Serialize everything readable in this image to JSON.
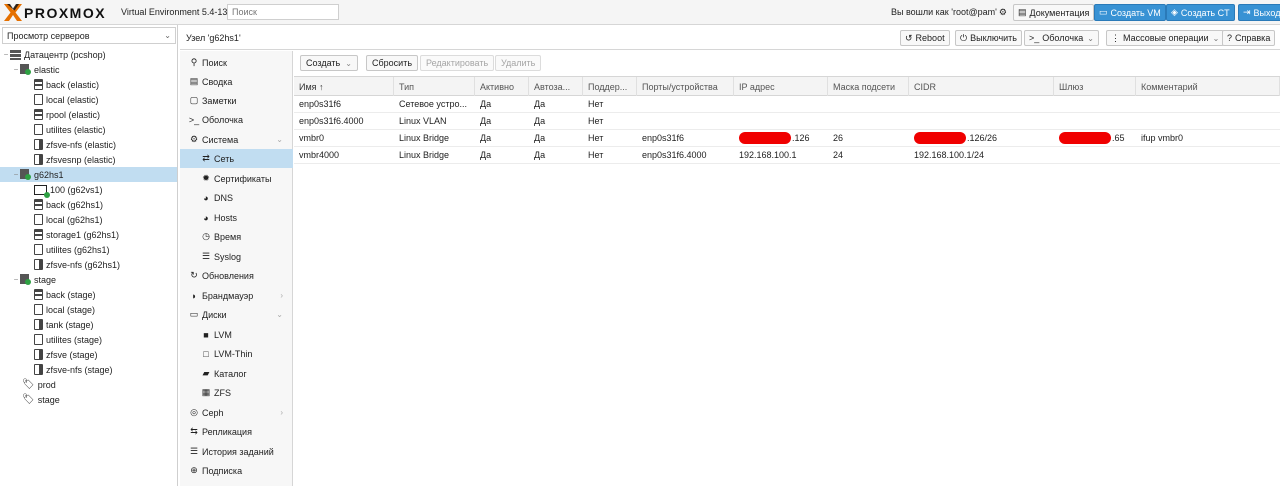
{
  "app": {
    "brand": "PROXMOX",
    "version": "Virtual Environment 5.4-13",
    "search_placeholder": "Поиск",
    "logged_in": "Вы вошли как 'root@pam'",
    "buttons": {
      "docs": "Документация",
      "create_vm": "Создать VM",
      "create_ct": "Создать CT",
      "logout": "Выход"
    },
    "accent_color": "#3892d4"
  },
  "tree": {
    "view_label": "Просмотр серверов",
    "items": [
      {
        "label": "Датацентр (pcshop)"
      },
      {
        "label": "elastic"
      },
      {
        "label": "back (elastic)"
      },
      {
        "label": "local (elastic)"
      },
      {
        "label": "rpool (elastic)"
      },
      {
        "label": "utilites (elastic)"
      },
      {
        "label": "zfsve-nfs (elastic)"
      },
      {
        "label": "zfsvesnp (elastic)"
      },
      {
        "label": "g62hs1"
      },
      {
        "label": "100 (g62vs1)"
      },
      {
        "label": "back (g62hs1)"
      },
      {
        "label": "local (g62hs1)"
      },
      {
        "label": "storage1 (g62hs1)"
      },
      {
        "label": "utilites (g62hs1)"
      },
      {
        "label": "zfsve-nfs (g62hs1)"
      },
      {
        "label": "stage"
      },
      {
        "label": "back (stage)"
      },
      {
        "label": "local (stage)"
      },
      {
        "label": "tank (stage)"
      },
      {
        "label": "utilites (stage)"
      },
      {
        "label": "zfsve (stage)"
      },
      {
        "label": "zfsve-nfs (stage)"
      },
      {
        "label": "prod"
      },
      {
        "label": "stage"
      }
    ]
  },
  "header": {
    "node_title": "Узел 'g62hs1'",
    "actions": {
      "reboot": "Reboot",
      "shutdown": "Выключить",
      "shell": "Оболочка",
      "bulk": "Массовые операции",
      "help": "Справка"
    }
  },
  "nav": {
    "items": [
      {
        "label": "Поиск"
      },
      {
        "label": "Сводка"
      },
      {
        "label": "Заметки"
      },
      {
        "label": "Оболочка"
      },
      {
        "label": "Система"
      },
      {
        "label": "Сеть"
      },
      {
        "label": "Сертификаты"
      },
      {
        "label": "DNS"
      },
      {
        "label": "Hosts"
      },
      {
        "label": "Время"
      },
      {
        "label": "Syslog"
      },
      {
        "label": "Обновления"
      },
      {
        "label": "Брандмауэр"
      },
      {
        "label": "Диски"
      },
      {
        "label": "LVM"
      },
      {
        "label": "LVM-Thin"
      },
      {
        "label": "Каталог"
      },
      {
        "label": "ZFS"
      },
      {
        "label": "Ceph"
      },
      {
        "label": "Репликация"
      },
      {
        "label": "История заданий"
      },
      {
        "label": "Подписка"
      }
    ]
  },
  "toolbar": {
    "create": "Создать",
    "reset": "Сбросить",
    "edit": "Редактировать",
    "delete": "Удалить"
  },
  "grid": {
    "columns": [
      "Имя ↑",
      "Тип",
      "Активно",
      "Автоза...",
      "Поддер...",
      "Порты/устройства",
      "IP адрес",
      "Маска подсети",
      "CIDR",
      "Шлюз",
      "Комментарий"
    ],
    "rows": [
      {
        "name": "enp0s31f6",
        "type": "Сетевое устро...",
        "active": "Да",
        "autostart": "Да",
        "vlan": "Нет",
        "ports": "",
        "ip": "",
        "mask": "",
        "cidr": "",
        "gateway": "",
        "comment": ""
      },
      {
        "name": "enp0s31f6.4000",
        "type": "Linux VLAN",
        "active": "Да",
        "autostart": "Да",
        "vlan": "Нет",
        "ports": "",
        "ip": "",
        "mask": "",
        "cidr": "",
        "gateway": "",
        "comment": ""
      },
      {
        "name": "vmbr0",
        "type": "Linux Bridge",
        "active": "Да",
        "autostart": "Да",
        "vlan": "Нет",
        "ports": "enp0s31f6",
        "ip": ".126",
        "mask": "26",
        "cidr": ".126/26",
        "gateway": ".65",
        "comment": "ifup vmbr0"
      },
      {
        "name": "vmbr4000",
        "type": "Linux Bridge",
        "active": "Да",
        "autostart": "Да",
        "vlan": "Нет",
        "ports": "enp0s31f6.4000",
        "ip": "192.168.100.1",
        "mask": "24",
        "cidr": "192.168.100.1/24",
        "gateway": "",
        "comment": ""
      }
    ]
  }
}
